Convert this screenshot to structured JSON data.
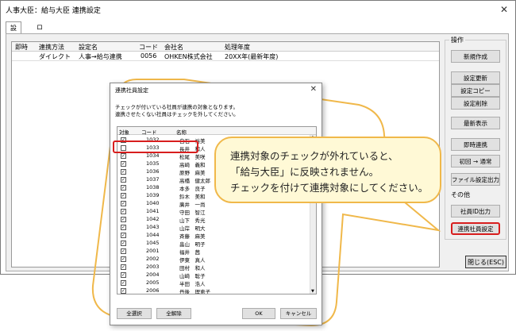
{
  "window": {
    "title": "人事大臣：給与大臣 連携設定",
    "close_glyph": "✕"
  },
  "tabs": [
    {
      "label": "設定"
    },
    {
      "label": "ログ"
    }
  ],
  "grid": {
    "headers": [
      "即時",
      "連携方法",
      "設定名",
      "コード",
      "会社名",
      "処理年度"
    ],
    "rows": [
      [
        "",
        "ダイレクト",
        "人事→給与連携",
        "0056",
        "OHKEN株式会社",
        "20XX年(最新年度)"
      ]
    ]
  },
  "side": {
    "group_label_operation": "操作",
    "group_label_other": "その他",
    "buttons": [
      "新規作成",
      "設定更新",
      "設定コピー",
      "設定削除",
      "最新表示",
      "即時連携",
      "初回 → 通常",
      "ファイル設定出力",
      "社員ID出力",
      "連携社員設定"
    ],
    "close_label": "閉じる(ESC)"
  },
  "dialog": {
    "title": "連携社員設定",
    "close_glyph": "✕",
    "desc1": "チェックが付いている社員が連携の対象となります。",
    "desc2": "連携させたくない社員はチェックを外してください。",
    "headers": [
      "対象",
      "コード",
      "名称"
    ],
    "rows": [
      {
        "checked": true,
        "code": "1032",
        "name": "白石　裕美"
      },
      {
        "checked": false,
        "code": "1033",
        "name": "長井　和人"
      },
      {
        "checked": true,
        "code": "1034",
        "name": "松尾　美咲"
      },
      {
        "checked": true,
        "code": "1035",
        "name": "高崎　義和"
      },
      {
        "checked": true,
        "code": "1036",
        "name": "原野　麻美"
      },
      {
        "checked": true,
        "code": "1037",
        "name": "高橋　健太郎"
      },
      {
        "checked": true,
        "code": "1038",
        "name": "本多　良子"
      },
      {
        "checked": true,
        "code": "1039",
        "name": "鈴木　美和"
      },
      {
        "checked": true,
        "code": "1040",
        "name": "廣井　一尚"
      },
      {
        "checked": true,
        "code": "1041",
        "name": "守田　智江"
      },
      {
        "checked": true,
        "code": "1042",
        "name": "山下　秀光"
      },
      {
        "checked": true,
        "code": "1043",
        "name": "山岸　明大"
      },
      {
        "checked": true,
        "code": "1044",
        "name": "斉藤　麻美"
      },
      {
        "checked": true,
        "code": "1045",
        "name": "畠山　明子"
      },
      {
        "checked": true,
        "code": "2001",
        "name": "福井　茜"
      },
      {
        "checked": true,
        "code": "2002",
        "name": "伊東　真人"
      },
      {
        "checked": true,
        "code": "2003",
        "name": "田村　和人"
      },
      {
        "checked": true,
        "code": "2004",
        "name": "山崎　聡子"
      },
      {
        "checked": true,
        "code": "2005",
        "name": "半田　浩人"
      },
      {
        "checked": true,
        "code": "2006",
        "name": "丹後　理恵子"
      }
    ],
    "btn_select_all": "全選択",
    "btn_clear_all": "全解除",
    "btn_ok": "OK",
    "btn_cancel": "キャンセル",
    "checkmark": "✓"
  },
  "callout": {
    "line1": "連携対象のチェックが外れていると、",
    "line2": "「給与大臣」に反映されません。",
    "line3": "チェックを付けて連携対象にしてください。"
  },
  "colors": {
    "highlight_red": "#d81e1e",
    "callout_border": "#f0b84a",
    "callout_fill": "#fff9d6"
  }
}
